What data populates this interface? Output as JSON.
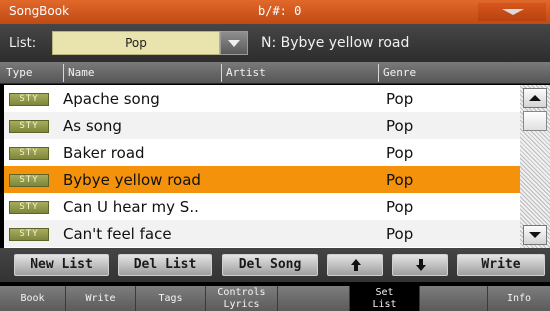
{
  "titlebar": {
    "title": "SongBook",
    "tempo_info": "b/#: 0",
    "menu_icon": "chevron-down-icon"
  },
  "list_row": {
    "label": "List:",
    "selected": "Pop",
    "song_name": "N: Bybye yellow road"
  },
  "columns": {
    "type": "Type",
    "name": "Name",
    "artist": "Artist",
    "genre": "Genre"
  },
  "rows": [
    {
      "type": "STY",
      "name": "Apache song",
      "artist": "",
      "genre": "Pop",
      "selected": false
    },
    {
      "type": "STY",
      "name": "As song",
      "artist": "",
      "genre": "Pop",
      "selected": false
    },
    {
      "type": "STY",
      "name": "Baker road",
      "artist": "",
      "genre": "Pop",
      "selected": false
    },
    {
      "type": "STY",
      "name": "Bybye yellow road",
      "artist": "",
      "genre": "Pop",
      "selected": true
    },
    {
      "type": "STY",
      "name": "Can U hear my S..",
      "artist": "",
      "genre": "Pop",
      "selected": false
    },
    {
      "type": "STY",
      "name": "Can't feel face",
      "artist": "",
      "genre": "Pop",
      "selected": false
    }
  ],
  "actions": {
    "new_list": "New List",
    "del_list": "Del List",
    "del_song": "Del Song",
    "move_up_icon": "arrow-up-icon",
    "move_down_icon": "arrow-down-icon",
    "write": "Write"
  },
  "tabs": [
    {
      "label": "Book",
      "active": false
    },
    {
      "label": "Write",
      "active": false
    },
    {
      "label": "Tags",
      "active": false
    },
    {
      "label": "Controls Lyrics",
      "line1": "Controls",
      "line2": "Lyrics",
      "active": false
    },
    {
      "label": "",
      "active": false
    },
    {
      "label": "Set List",
      "line1": "Set",
      "line2": "List",
      "active": true
    },
    {
      "label": "",
      "active": false
    },
    {
      "label": "Info",
      "active": false
    }
  ],
  "colors": {
    "titlebar": "#d05820",
    "selection": "#f4920c",
    "type_badge": "#959b4b",
    "list_select_bg": "#e9e3ad"
  }
}
